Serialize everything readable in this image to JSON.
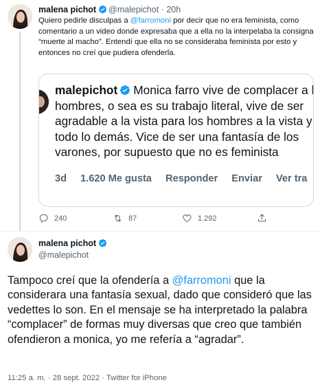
{
  "reply_tweet": {
    "author_name": "malena pichot",
    "author_handle": "@malepichot",
    "separator": "·",
    "time": "20h",
    "text_before_mention": "Quiero pedirle disculpas a ",
    "mention": "@farromoni",
    "text_after_mention": " por decir que no era feminista, como comentario a un video donde expresaba que a ella no la interpelaba la consigna “muerte al macho”. Entendí que ella no se consideraba feminista por esto y entonces no creí que pudiera ofenderla.",
    "quoted_screenshot": {
      "handle": "malepichot",
      "text": "Monica farro vive de complacer a los hombres, o sea es su trabajo literal, vive de ser agradable a la vista para los hombres a la vista y a todo lo demás. Vice de ser una fantasía de los varones, por supuesto que no es feminista",
      "age": "3d",
      "likes": "1.620 Me gusta",
      "reply_label": "Responder",
      "send_label": "Enviar",
      "more_label": "Ver tra"
    },
    "actions": {
      "replies": "240",
      "retweets": "87",
      "likes": "1.292"
    }
  },
  "main_tweet": {
    "author_name": "malena pichot",
    "author_handle": "@malepichot",
    "text_before_mention": "Tampoco creí que la ofendería a ",
    "mention": "@farromoni",
    "text_after_mention": " que la considerara una fantasía sexual, dado que consideró que las vedettes lo son. En el mensaje se ha interpretado la palabra “complacer” de formas muy diversas que creo que también ofendieron a monica, yo me refería a “agradar”.",
    "timestamp": "11:25 a. m. · 28 sept. 2022 · Twitter for iPhone"
  },
  "colors": {
    "accent": "#1d9bf0",
    "text": "#0f1419",
    "secondary": "#536471",
    "border": "#cfd9de"
  },
  "icons": [
    "verified-badge-icon",
    "reply-icon",
    "retweet-icon",
    "like-icon",
    "share-icon"
  ]
}
